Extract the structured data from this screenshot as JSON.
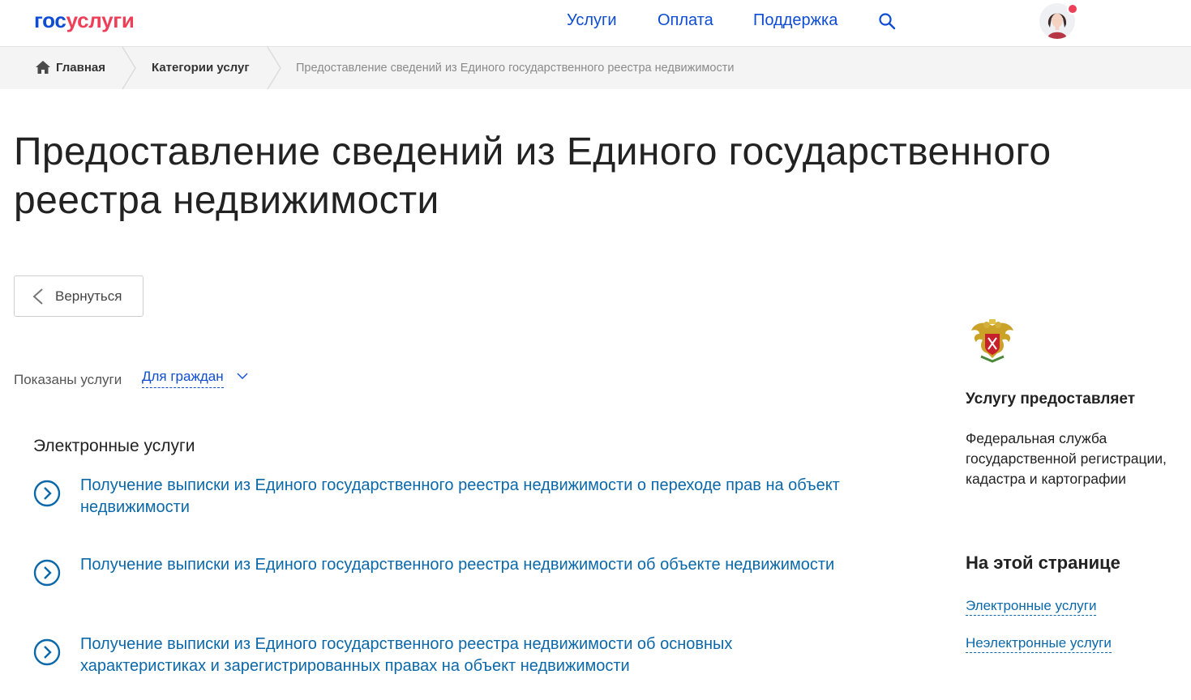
{
  "header": {
    "logo_part1": "гос",
    "logo_part2": "услуги",
    "nav": [
      "Услуги",
      "Оплата",
      "Поддержка"
    ]
  },
  "breadcrumb": {
    "home": "Главная",
    "category": "Категории услуг",
    "current": "Предоставление сведений из Единого государственного реестра недвижимости"
  },
  "page_title": "Предоставление сведений из Единого государственного реестра недвижимости",
  "back_button": "Вернуться",
  "filter": {
    "label": "Показаны услуги",
    "value": "Для граждан"
  },
  "section_title": "Электронные услуги",
  "services": [
    "Получение выписки из Единого государственного реестра недвижимости о переходе прав на объект недвижимости",
    "Получение выписки из Единого государственного реестра недвижимости об объекте недвижимости",
    "Получение выписки из Единого государственного реестра недвижимости об основных характеристиках и зарегистрированных правах на объект недвижимости"
  ],
  "sidebar": {
    "provider_title": "Услугу предоставляет",
    "provider_name": "Федеральная служба государственной регистрации, кадастра и картографии",
    "on_page_title": "На этой странице",
    "links": [
      "Электронные услуги",
      "Неэлектронные услуги"
    ]
  },
  "colors": {
    "brand_blue": "#0d4cd3",
    "brand_red": "#ee3f58",
    "link_blue": "#0b68a9"
  }
}
